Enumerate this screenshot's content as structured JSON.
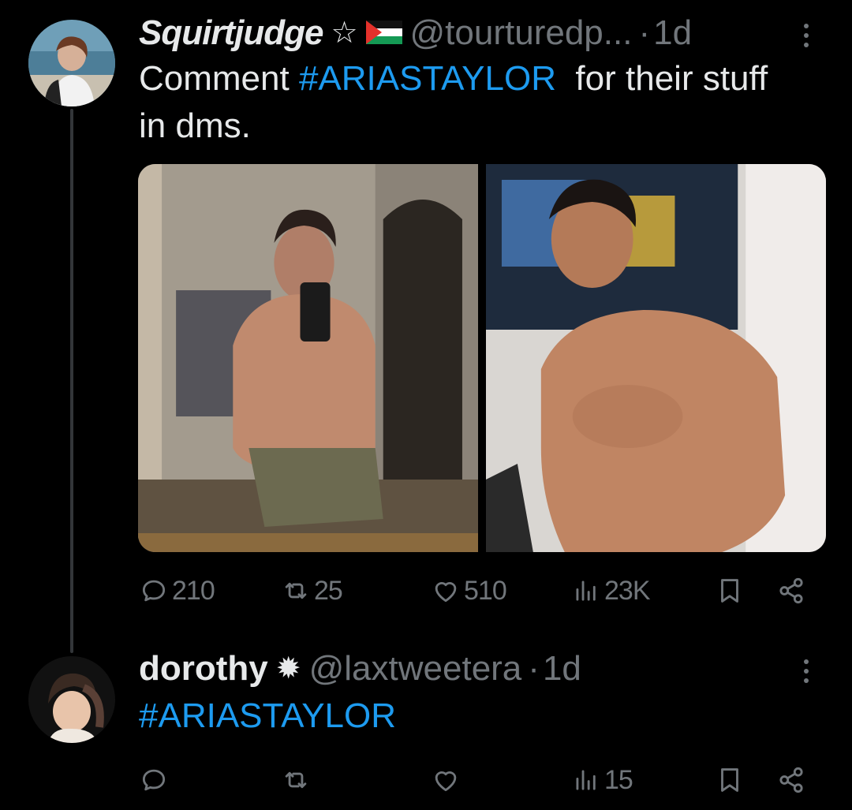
{
  "tweets": [
    {
      "display_name": "Squirtjudge",
      "badges": [
        "☆",
        "flag-palestine"
      ],
      "handle": "@tourturedp...",
      "time": "1d",
      "text_before": "Comment ",
      "hashtag": "#ARIASTAYLOR",
      "text_after": "  for their stuff in dms.",
      "stats": {
        "replies": "210",
        "retweets": "25",
        "likes": "510",
        "views": "23K"
      },
      "media_count": 2
    },
    {
      "display_name": "dorothy",
      "badges": [
        "✹"
      ],
      "handle": "@laxtweetera",
      "time": "1d",
      "hashtag": "#ARIASTAYLOR",
      "stats": {
        "replies": "",
        "retweets": "",
        "likes": "",
        "views": "15"
      }
    }
  ],
  "icons": {
    "reply": "reply-icon",
    "retweet": "retweet-icon",
    "like": "heart-icon",
    "views": "views-icon",
    "bookmark": "bookmark-icon",
    "share": "share-icon",
    "more": "more-icon"
  },
  "colors": {
    "background": "#000000",
    "text": "#e7e9ea",
    "secondary": "#71767b",
    "hashtag": "#1d9bf0"
  }
}
